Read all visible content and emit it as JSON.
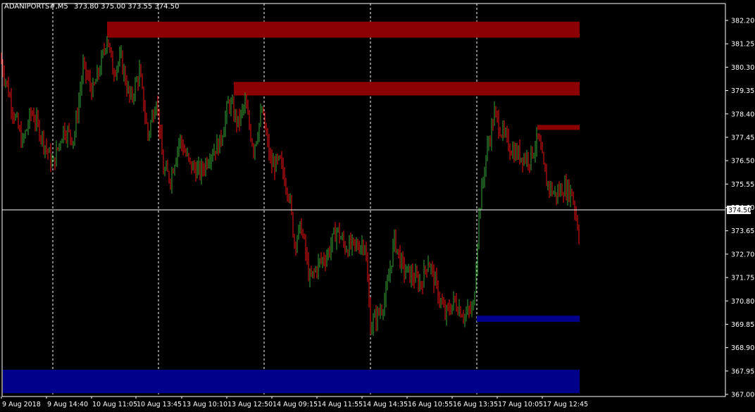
{
  "header": {
    "symbol_timeframe": "ADANIPORTS#,M5",
    "ohlc": "373.80 375.00 373.55 374.50"
  },
  "colors": {
    "background": "#000000",
    "axis": "#ffffff",
    "grid": "#ffffff",
    "candle_up": "#2e8b2e",
    "candle_down": "#cc1010",
    "resistance_zone": "#8b0000",
    "support_zone": "#00008b",
    "price_line": "#ffffff"
  },
  "chart_data": {
    "type": "candlestick",
    "title": "",
    "xlabel": "",
    "ylabel": "",
    "ylim": [
      366.8,
      382.7
    ],
    "y_ticks": [
      367.0,
      367.95,
      368.9,
      369.85,
      370.8,
      371.75,
      372.7,
      373.65,
      374.6,
      375.55,
      376.5,
      377.45,
      378.4,
      379.35,
      380.3,
      381.25,
      382.2
    ],
    "y_tick_labels": [
      "367.00",
      "367.95",
      "368.90",
      "369.85",
      "370.80",
      "371.75",
      "372.70",
      "373.65",
      "374.60",
      "375.55",
      "376.50",
      "377.45",
      "378.40",
      "379.35",
      "380.30",
      "381.25",
      "382.20"
    ],
    "x_labels": [
      "9 Aug 2018",
      "9 Aug 14:40",
      "10 Aug 11:05",
      "10 Aug 13:45",
      "13 Aug 10:10",
      "13 Aug 12:50",
      "14 Aug 09:15",
      "14 Aug 11:55",
      "14 Aug 14:35",
      "16 Aug 10:55",
      "16 Aug 13:35",
      "17 Aug 10:05",
      "17 Aug 12:45"
    ],
    "day_separator_labels": [
      "9 Aug 14:40",
      "10 Aug 13:45",
      "13 Aug 12:50",
      "14 Aug 14:35",
      "16 Aug 13:35"
    ],
    "current_price": 374.5,
    "current_price_label": "374.50",
    "zones": [
      {
        "name": "resistance",
        "from_label": "10 Aug 11:05",
        "y_low": 381.5,
        "y_high": 382.15,
        "color": "#8b0000"
      },
      {
        "name": "resistance",
        "from_label": "13 Aug 10:10",
        "y_low": 379.15,
        "y_high": 379.7,
        "color": "#8b0000"
      },
      {
        "name": "resistance",
        "from_label": "17 Aug 10:05",
        "y_low": 377.75,
        "y_high": 377.95,
        "color": "#8b0000"
      },
      {
        "name": "support",
        "from_label": "16 Aug 13:35",
        "y_low": 369.95,
        "y_high": 370.2,
        "color": "#00008b"
      },
      {
        "name": "support",
        "from_label": "9 Aug 2018",
        "y_low": 367.05,
        "y_high": 368.0,
        "color": "#00008b"
      }
    ],
    "price_path": [
      [
        0,
        380.7
      ],
      [
        8,
        379.8
      ],
      [
        18,
        378.6
      ],
      [
        32,
        377.2
      ],
      [
        45,
        378.5
      ],
      [
        58,
        377.6
      ],
      [
        75,
        376.3
      ],
      [
        90,
        377.8
      ],
      [
        105,
        377.4
      ],
      [
        118,
        380.3
      ],
      [
        132,
        379.3
      ],
      [
        145,
        380.6
      ],
      [
        152,
        381.6
      ],
      [
        160,
        380.2
      ],
      [
        172,
        380.6
      ],
      [
        185,
        378.9
      ],
      [
        198,
        380.1
      ],
      [
        210,
        377.5
      ],
      [
        222,
        379.1
      ],
      [
        232,
        376.1
      ],
      [
        242,
        375.8
      ],
      [
        255,
        377.4
      ],
      [
        270,
        376.3
      ],
      [
        285,
        376.0
      ],
      [
        298,
        376.8
      ],
      [
        312,
        377.2
      ],
      [
        325,
        378.9
      ],
      [
        338,
        378.0
      ],
      [
        348,
        378.8
      ],
      [
        360,
        377.0
      ],
      [
        372,
        378.5
      ],
      [
        385,
        376.3
      ],
      [
        398,
        376.4
      ],
      [
        410,
        375.2
      ],
      [
        418,
        373.2
      ],
      [
        428,
        373.8
      ],
      [
        440,
        371.6
      ],
      [
        452,
        372.3
      ],
      [
        465,
        372.7
      ],
      [
        478,
        373.7
      ],
      [
        490,
        373.0
      ],
      [
        505,
        373.0
      ],
      [
        518,
        373.2
      ],
      [
        526,
        369.8
      ],
      [
        538,
        370.3
      ],
      [
        548,
        371.0
      ],
      [
        560,
        373.3
      ],
      [
        572,
        372.1
      ],
      [
        585,
        371.8
      ],
      [
        598,
        371.5
      ],
      [
        608,
        372.5
      ],
      [
        620,
        371.3
      ],
      [
        632,
        370.2
      ],
      [
        645,
        370.8
      ],
      [
        660,
        370.2
      ],
      [
        672,
        370.5
      ],
      [
        680,
        374.3
      ],
      [
        690,
        376.7
      ],
      [
        702,
        378.4
      ],
      [
        715,
        377.5
      ],
      [
        728,
        376.9
      ],
      [
        740,
        376.7
      ],
      [
        752,
        376.6
      ],
      [
        764,
        377.4
      ],
      [
        775,
        375.7
      ],
      [
        788,
        375.1
      ],
      [
        800,
        375.4
      ],
      [
        812,
        375.2
      ],
      [
        822,
        373.6
      ]
    ]
  }
}
